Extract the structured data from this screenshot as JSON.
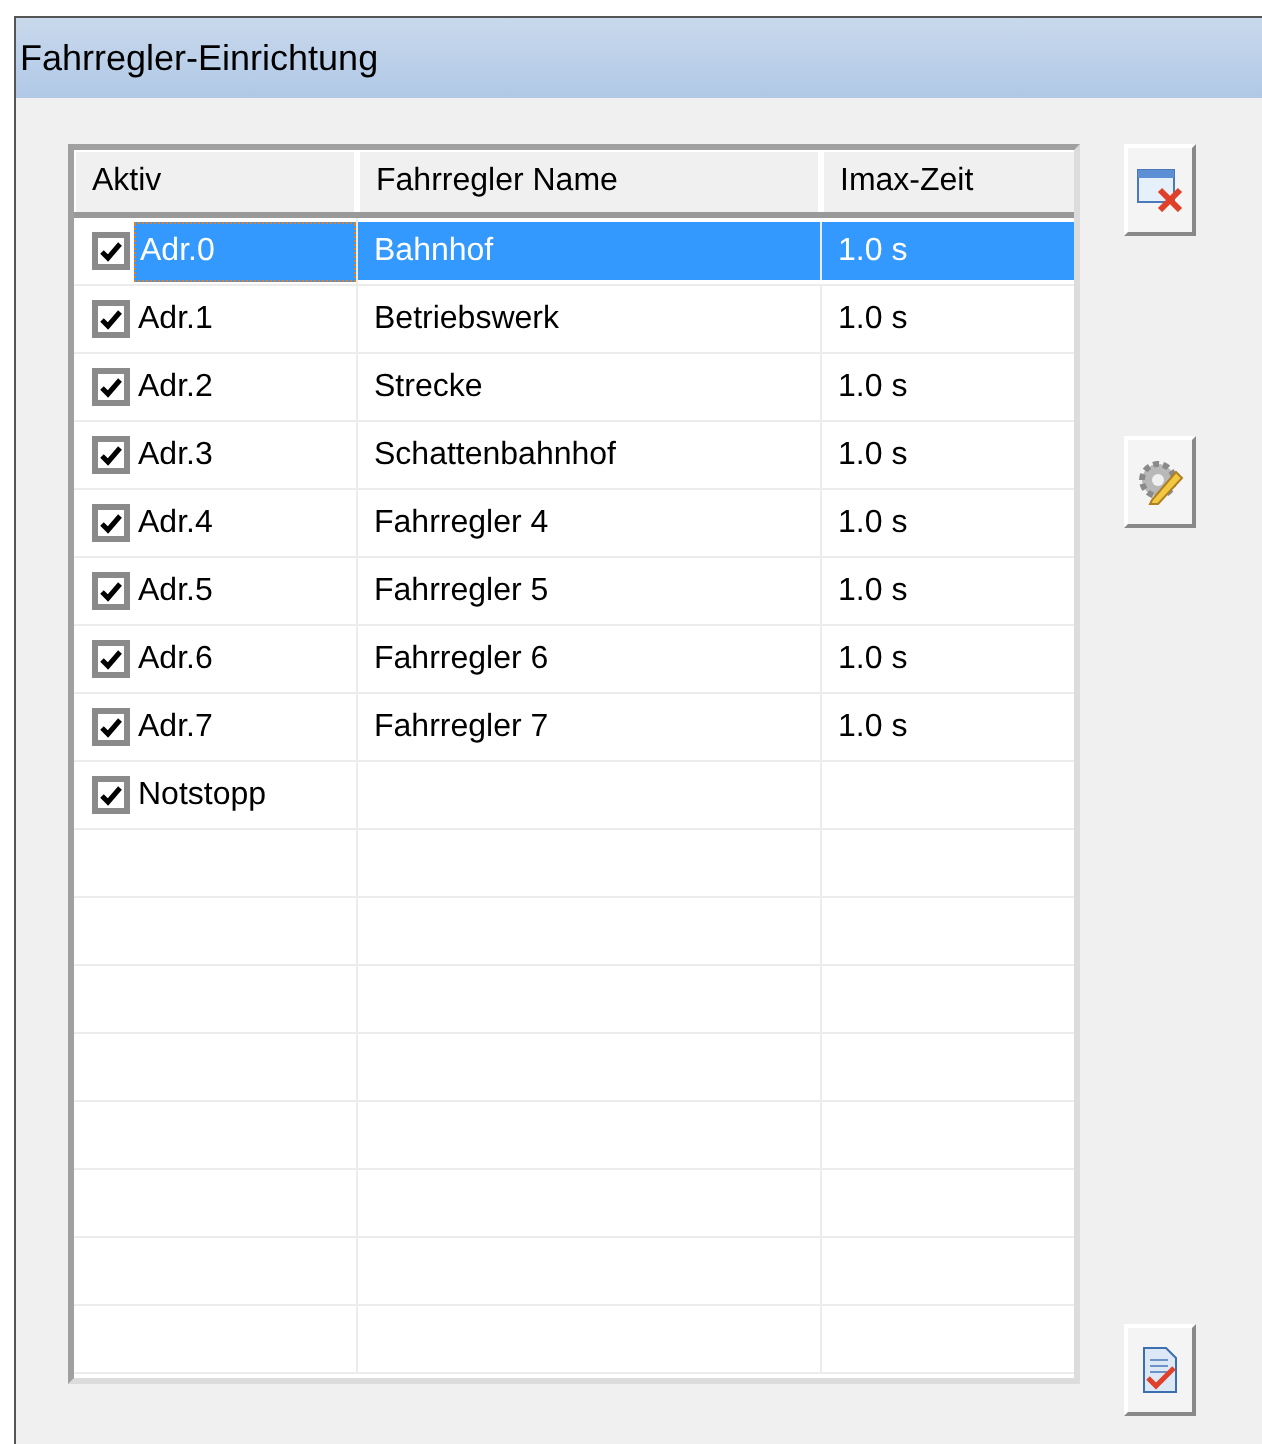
{
  "window": {
    "title": "Fahrregler-Einrichtung"
  },
  "table": {
    "columns": [
      "Aktiv",
      "Fahrregler Name",
      "Imax-Zeit"
    ],
    "rows": [
      {
        "checked": true,
        "address": "Adr.0",
        "name": "Bahnhof",
        "time": "1.0 s",
        "selected": true
      },
      {
        "checked": true,
        "address": "Adr.1",
        "name": "Betriebswerk",
        "time": "1.0 s",
        "selected": false
      },
      {
        "checked": true,
        "address": "Adr.2",
        "name": "Strecke",
        "time": "1.0 s",
        "selected": false
      },
      {
        "checked": true,
        "address": "Adr.3",
        "name": "Schattenbahnhof",
        "time": "1.0 s",
        "selected": false
      },
      {
        "checked": true,
        "address": "Adr.4",
        "name": "Fahrregler 4",
        "time": "1.0 s",
        "selected": false
      },
      {
        "checked": true,
        "address": "Adr.5",
        "name": "Fahrregler 5",
        "time": "1.0 s",
        "selected": false
      },
      {
        "checked": true,
        "address": "Adr.6",
        "name": "Fahrregler 6",
        "time": "1.0 s",
        "selected": false
      },
      {
        "checked": true,
        "address": "Adr.7",
        "name": "Fahrregler 7",
        "time": "1.0 s",
        "selected": false
      },
      {
        "checked": true,
        "address": "Notstopp",
        "selected": false
      }
    ]
  },
  "toolbar": [
    {
      "kind": "close"
    },
    {
      "kind": "settings"
    },
    {
      "kind": "apply"
    }
  ]
}
